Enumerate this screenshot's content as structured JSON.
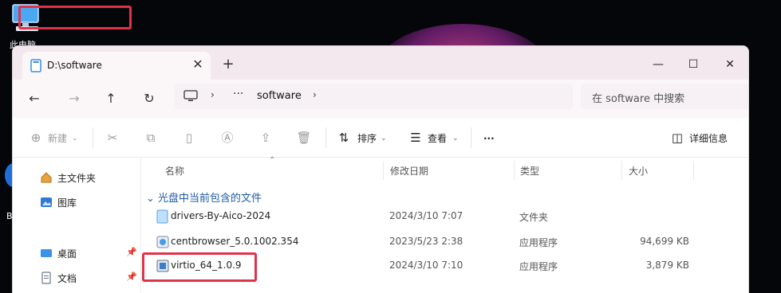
{
  "desktop": {
    "icon_label": "此电脑",
    "edge_text": "B"
  },
  "window": {
    "tab_title": "D:\\software",
    "new_tab": "+",
    "controls": {
      "minimize": "—",
      "maximize": "☐",
      "close": "✕"
    }
  },
  "nav": {
    "back": "←",
    "forward": "→",
    "up": "↑",
    "refresh": "↻",
    "breadcrumb_more": "···",
    "breadcrumb_segment": "software",
    "search_placeholder": "在 software 中搜索"
  },
  "toolbar": {
    "new_label": "新建",
    "sort_label": "排序",
    "view_label": "查看",
    "more_label": "···",
    "details_label": "详细信息"
  },
  "sidebar": {
    "items": [
      {
        "label": "主文件夹",
        "pinned": false
      },
      {
        "label": "图库",
        "pinned": false
      },
      {
        "label": "桌面",
        "pinned": true
      },
      {
        "label": "文档",
        "pinned": true
      }
    ]
  },
  "list": {
    "headers": {
      "name": "名称",
      "date": "修改日期",
      "type": "类型",
      "size": "大小"
    },
    "group": "光盘中当前包含的文件",
    "rows": [
      {
        "name": "drivers-By-Aico-2024",
        "date": "2024/3/10 7:07",
        "type": "文件夹",
        "size": ""
      },
      {
        "name": "centbrowser_5.0.1002.354",
        "date": "2023/5/23 2:38",
        "type": "应用程序",
        "size": "94,699 KB"
      },
      {
        "name": "virtio_64_1.0.9",
        "date": "2024/3/10 7:10",
        "type": "应用程序",
        "size": "3,879 KB"
      }
    ]
  },
  "colors": {
    "accent_highlight": "#e0324a",
    "titlebar": "#f3e8ee",
    "group_text": "#1f5aa6"
  }
}
